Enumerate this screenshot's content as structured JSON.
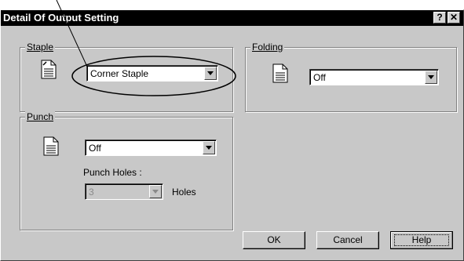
{
  "dialog": {
    "title": "Detail Of Output Setting",
    "help_glyph": "?",
    "close_glyph": "✕"
  },
  "staple": {
    "label": "Staple",
    "selected": "Corner Staple"
  },
  "folding": {
    "label": "Folding",
    "selected": "Off"
  },
  "punch": {
    "label": "Punch",
    "selected": "Off",
    "holes_label": "Punch Holes :",
    "holes_value": "3",
    "holes_unit": "Holes"
  },
  "buttons": {
    "ok": "OK",
    "cancel": "Cancel",
    "help": "Help"
  },
  "icons": {
    "staple_icon": "document-staple-icon",
    "folding_icon": "document-icon",
    "punch_icon": "document-icon"
  }
}
